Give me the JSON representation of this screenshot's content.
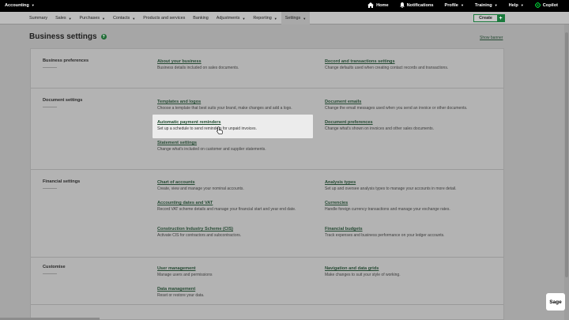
{
  "topbar": {
    "app_name": "Accounting",
    "home": "Home",
    "notifications": "Notifications",
    "profile": "Profile",
    "training": "Training",
    "help": "Help",
    "copilot": "Copilot"
  },
  "nav": {
    "items": [
      "Summary",
      "Sales",
      "Purchases",
      "Contacts",
      "Products and services",
      "Banking",
      "Adjustments",
      "Reporting",
      "Settings"
    ],
    "create_label": "Create",
    "create_plus": "+"
  },
  "page": {
    "title": "Business settings",
    "help_glyph": "?",
    "show_banner": "Show banner"
  },
  "sections": {
    "business_preferences": {
      "title": "Business preferences",
      "about_business": {
        "link": "About your business",
        "desc": "Business details included on sales documents."
      },
      "record_transactions": {
        "link": "Record and transactions settings",
        "desc": "Change defaults used when creating contact records and transactions."
      }
    },
    "document_settings": {
      "title": "Document settings",
      "templates_logos": {
        "link": "Templates and logos",
        "desc": "Choose a template that best suits your brand, make changes and add a logo."
      },
      "document_emails": {
        "link": "Document emails",
        "desc": "Change the email messages used when you send an invoice or other documents."
      },
      "payment_reminders": {
        "link": "Automatic payment reminders",
        "desc": "Set up a schedule to send reminders for unpaid invoices."
      },
      "document_preferences": {
        "link": "Document preferences",
        "desc": "Change what's shown on invoices and other sales documents."
      },
      "statement_settings": {
        "link": "Statement settings",
        "desc": "Change what's included on customer and supplier statements."
      }
    },
    "financial_settings": {
      "title": "Financial settings",
      "chart_of_accounts": {
        "link": "Chart of accounts",
        "desc": "Create, view and manage your nominal accounts."
      },
      "analysis_types": {
        "link": "Analysis types",
        "desc": "Set up and oversee analysis types to manage your accounts in more detail."
      },
      "accounting_dates_vat": {
        "link": "Accounting dates and VAT",
        "desc": "Record VAT scheme details and manage your financial start and year end date."
      },
      "currencies": {
        "link": "Currencies",
        "desc": "Handle foreign currency transactions and manage your exchange rates."
      },
      "cis": {
        "link": "Construction Industry Scheme (CIS)",
        "desc": "Activate CIS for contractors and subcontractors."
      },
      "financial_budgets": {
        "link": "Financial budgets",
        "desc": "Track expenses and business performance on your ledger accounts."
      }
    },
    "customise": {
      "title": "Customise",
      "user_management": {
        "link": "User management",
        "desc": "Manage users and permissions"
      },
      "navigation_grids": {
        "link": "Navigation and data grids",
        "desc": "Make changes to suit your style of working."
      },
      "data_management": {
        "link": "Data management",
        "desc": "Reset or restore your data."
      }
    }
  },
  "widget": {
    "label": "Sage"
  }
}
